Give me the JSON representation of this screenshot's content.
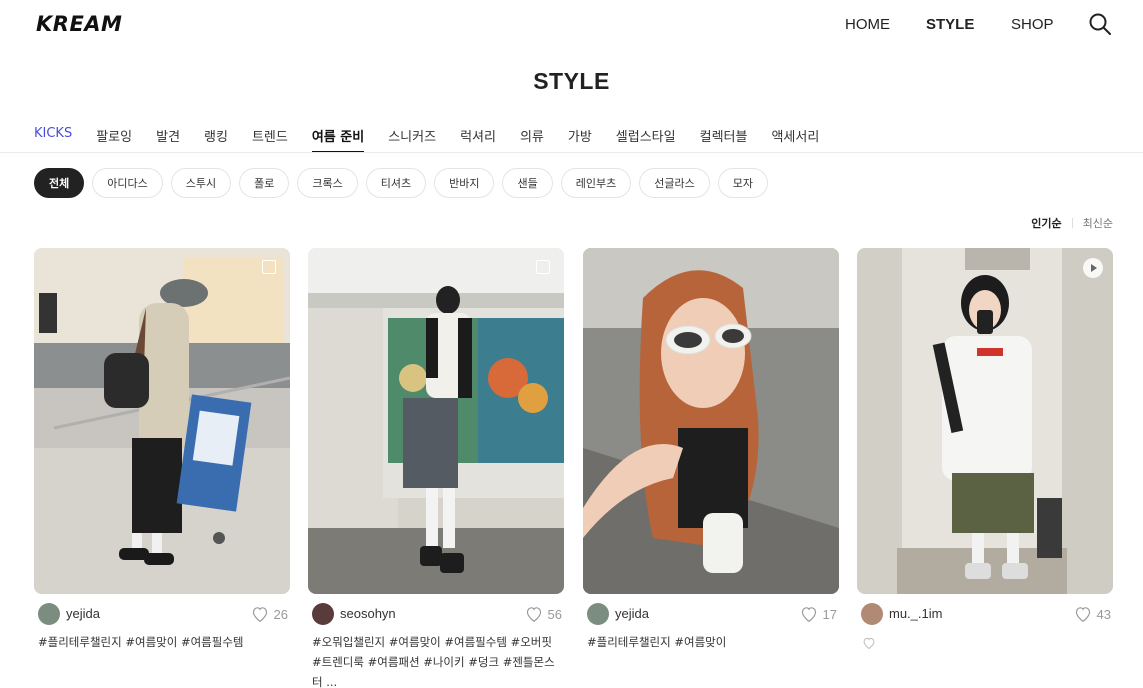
{
  "header": {
    "logo": "KREAM",
    "nav": [
      "HOME",
      "STYLE",
      "SHOP"
    ],
    "active_nav": "STYLE",
    "search_icon": "search-icon"
  },
  "page_title": "STYLE",
  "tabs": [
    "KICKS",
    "팔로잉",
    "발견",
    "랭킹",
    "트렌드",
    "여름 준비",
    "스니커즈",
    "럭셔리",
    "의류",
    "가방",
    "셀럽스타일",
    "컬렉터블",
    "액세서리"
  ],
  "active_tab": "여름 준비",
  "chips": [
    "전체",
    "아디다스",
    "스투시",
    "폴로",
    "크록스",
    "티셔츠",
    "반바지",
    "샌들",
    "레인부츠",
    "선글라스",
    "모자"
  ],
  "active_chip": "전체",
  "sort": {
    "popular": "인기순",
    "latest": "최신순",
    "active": "인기순"
  },
  "posts": [
    {
      "user": "yejida",
      "likes": "26",
      "tags": "#플리테루챌린지 #여름맞이 #여름필수템",
      "badge": "multi-photo-icon"
    },
    {
      "user": "seosohyn",
      "likes": "56",
      "tags": "#오뭐입챌린지 #여름맞이 #여름필수템 #오버핏 #트렌디룩 #여름패션 #나이키 #덩크 #젠틀몬스터 ...",
      "badge": "multi-photo-icon"
    },
    {
      "user": "yejida",
      "likes": "17",
      "tags": "#플리테루챌린지 #여름맞이",
      "badge": ""
    },
    {
      "user": "mu._.1im",
      "likes": "43",
      "tags": "",
      "badge": "play-icon"
    }
  ],
  "colors": {
    "accent": "#4a4cdf",
    "text": "#222222",
    "muted": "#999999",
    "chip_active": "#222222"
  }
}
